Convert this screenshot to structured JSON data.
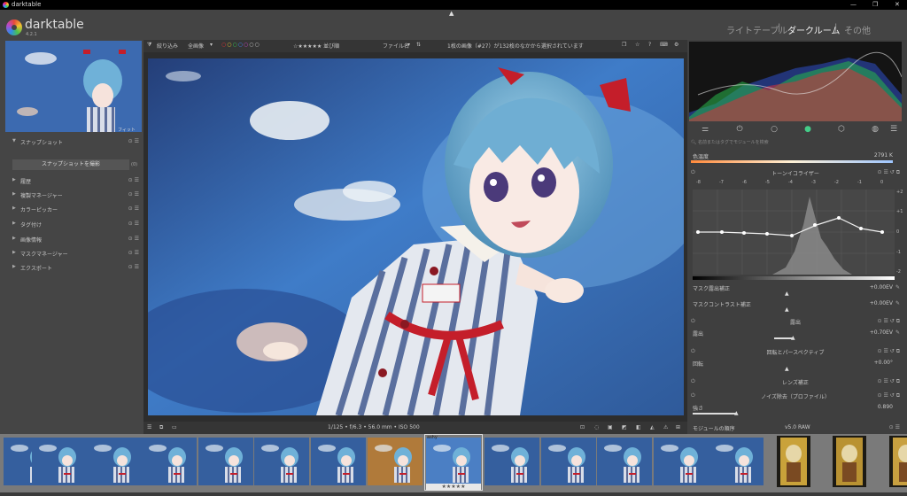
{
  "titlebar": {
    "app_name": "darktable"
  },
  "brand": {
    "name": "darktable",
    "version": "4.2.1"
  },
  "views": [
    {
      "label": "ライトテーブル"
    },
    {
      "label": "|"
    },
    {
      "label": "ダークルーム"
    },
    {
      "label": "|"
    },
    {
      "label": "その他"
    }
  ],
  "navigation": {
    "zoom_label": "フィット"
  },
  "left_panel": {
    "snapshot": {
      "label": "スナップショット",
      "button": "スナップショットを撮影",
      "count": "(0)"
    },
    "modules": [
      {
        "label": "履歴"
      },
      {
        "label": "複製マネージャー"
      },
      {
        "label": "カラーピッカー"
      },
      {
        "label": "タグ付け"
      },
      {
        "label": "画像情報"
      },
      {
        "label": "マスクマネージャー"
      },
      {
        "label": "エクスポート"
      }
    ]
  },
  "center_toolbar": {
    "filter_label": "絞り込み",
    "filter_value": "全画像",
    "rating_filter": "☆★★★★★ 並び順",
    "sort_value": "ファイル名",
    "status": "1枚の画像（#27）が132枚のなかから選択されています"
  },
  "bottom_bar": {
    "exif": "1/125 • f/6.3 • 56.0 mm • ISO 500"
  },
  "right_panel": {
    "search_placeholder": "名前またはタグでモジュールを検索",
    "white_balance": {
      "label": "色温度",
      "value": "2791 K"
    },
    "tone_equalizer": {
      "title": "トーンイコライザー",
      "ev_ticks": [
        "-8",
        "-7",
        "-6",
        "-5",
        "-4",
        "-3",
        "-2",
        "-1",
        "0"
      ],
      "right_ticks": [
        "+2",
        "+1",
        "0",
        "-1",
        "-2"
      ]
    },
    "mask_exposure": {
      "label": "マスク露出補正",
      "value": "+0.00EV"
    },
    "mask_contrast": {
      "label": "マスクコントラスト補正",
      "value": "+0.00EV"
    },
    "exposure": {
      "title": "露出",
      "label": "露出",
      "value": "+0.70EV"
    },
    "perspective": {
      "title": "回転とパースペクティブ",
      "label": "回転",
      "value": "+0.00°"
    },
    "lens": {
      "title": "レンズ補正"
    },
    "denoise": {
      "title": "ノイズ除去（プロファイル）",
      "label": "強さ",
      "value": "0.890"
    },
    "footer": {
      "label": "モジュールの順序",
      "value": "v5.0 RAW"
    }
  },
  "filmstrip": {
    "selected_label": "ashy",
    "selected_stars": "★★★★★",
    "selected_index": 8
  },
  "colors": {
    "accent": "#f0f0f0",
    "panel": "#454545",
    "background": "#2b2b2b"
  }
}
